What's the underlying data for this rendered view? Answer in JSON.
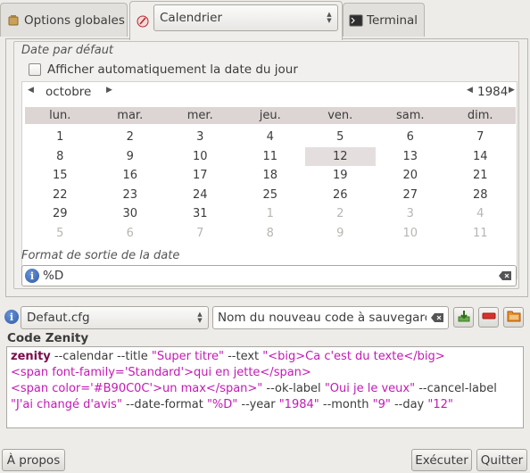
{
  "tabs": [
    {
      "label": "Options globales",
      "icon": "gear-icon"
    },
    {
      "label": "Calendrier",
      "icon": "calendar-icon"
    },
    {
      "label": "Terminal",
      "icon": "terminal-icon"
    }
  ],
  "dialog_type_select": {
    "value": "Calendrier"
  },
  "date_section": {
    "label": "Date par défaut",
    "auto_date_label": "Afficher automatiquement la date du jour",
    "auto_date_checked": false
  },
  "calendar": {
    "month": "octobre",
    "year": "1984",
    "weekdays": [
      "lun.",
      "mar.",
      "mer.",
      "jeu.",
      "ven.",
      "sam.",
      "dim."
    ],
    "weeks": [
      [
        [
          "1",
          0
        ],
        [
          "2",
          0
        ],
        [
          "3",
          0
        ],
        [
          "4",
          0
        ],
        [
          "5",
          0
        ],
        [
          "6",
          0
        ],
        [
          "7",
          0
        ]
      ],
      [
        [
          "8",
          0
        ],
        [
          "9",
          0
        ],
        [
          "10",
          0
        ],
        [
          "11",
          0
        ],
        [
          "12",
          0
        ],
        [
          "13",
          0
        ],
        [
          "14",
          0
        ]
      ],
      [
        [
          "15",
          0
        ],
        [
          "16",
          0
        ],
        [
          "17",
          0
        ],
        [
          "18",
          0
        ],
        [
          "19",
          0
        ],
        [
          "20",
          0
        ],
        [
          "21",
          0
        ]
      ],
      [
        [
          "22",
          0
        ],
        [
          "23",
          0
        ],
        [
          "24",
          0
        ],
        [
          "25",
          0
        ],
        [
          "26",
          0
        ],
        [
          "27",
          0
        ],
        [
          "28",
          0
        ]
      ],
      [
        [
          "29",
          0
        ],
        [
          "30",
          0
        ],
        [
          "31",
          0
        ],
        [
          "1",
          1
        ],
        [
          "2",
          1
        ],
        [
          "3",
          1
        ],
        [
          "4",
          1
        ]
      ],
      [
        [
          "5",
          1
        ],
        [
          "6",
          1
        ],
        [
          "7",
          1
        ],
        [
          "8",
          1
        ],
        [
          "9",
          1
        ],
        [
          "10",
          1
        ],
        [
          "11",
          1
        ]
      ]
    ],
    "selected_day": "12"
  },
  "format_section": {
    "label": "Format de sortie de la date",
    "value": "%D"
  },
  "toolbar": {
    "config_select": "Defaut.cfg",
    "name_input_placeholder": "Nom du nouveau code à sauvegarder",
    "save_icon": "save-icon",
    "delete_icon": "delete-icon",
    "open_icon": "open-folder-icon"
  },
  "code": {
    "title": "Code Zenity",
    "parts": [
      {
        "t": "zenity",
        "c": "k"
      },
      {
        "t": " --calendar --title ",
        "c": ""
      },
      {
        "t": "\"Super titre\"",
        "c": "s"
      },
      {
        "t": " --text ",
        "c": ""
      },
      {
        "t": "\"<big>Ca c'est du texte</big>\n<span font-family='Standard'>qui en jette</span>\n<span color='#B90C0C'>un max</span>\"",
        "c": "s"
      },
      {
        "t": " --ok-label ",
        "c": ""
      },
      {
        "t": "\"Oui je le veux\"",
        "c": "s"
      },
      {
        "t": " --cancel-label ",
        "c": ""
      },
      {
        "t": "\"J'ai changé d'avis\"",
        "c": "s"
      },
      {
        "t": " --date-format ",
        "c": ""
      },
      {
        "t": "\"%D\"",
        "c": "s"
      },
      {
        "t": " --year ",
        "c": ""
      },
      {
        "t": "\"1984\"",
        "c": "s"
      },
      {
        "t": " --month ",
        "c": ""
      },
      {
        "t": "\"9\"",
        "c": "s"
      },
      {
        "t": " --day ",
        "c": ""
      },
      {
        "t": "\"12\"",
        "c": "s"
      }
    ]
  },
  "buttons": {
    "about": "À propos",
    "execute": "Exécuter",
    "quit": "Quitter"
  },
  "colors": {
    "keyword": "#7a0b4a",
    "string": "#c31ab4",
    "selected_day_bg": "#e4dfde",
    "weekday_header_bg": "#dcd5d3"
  }
}
